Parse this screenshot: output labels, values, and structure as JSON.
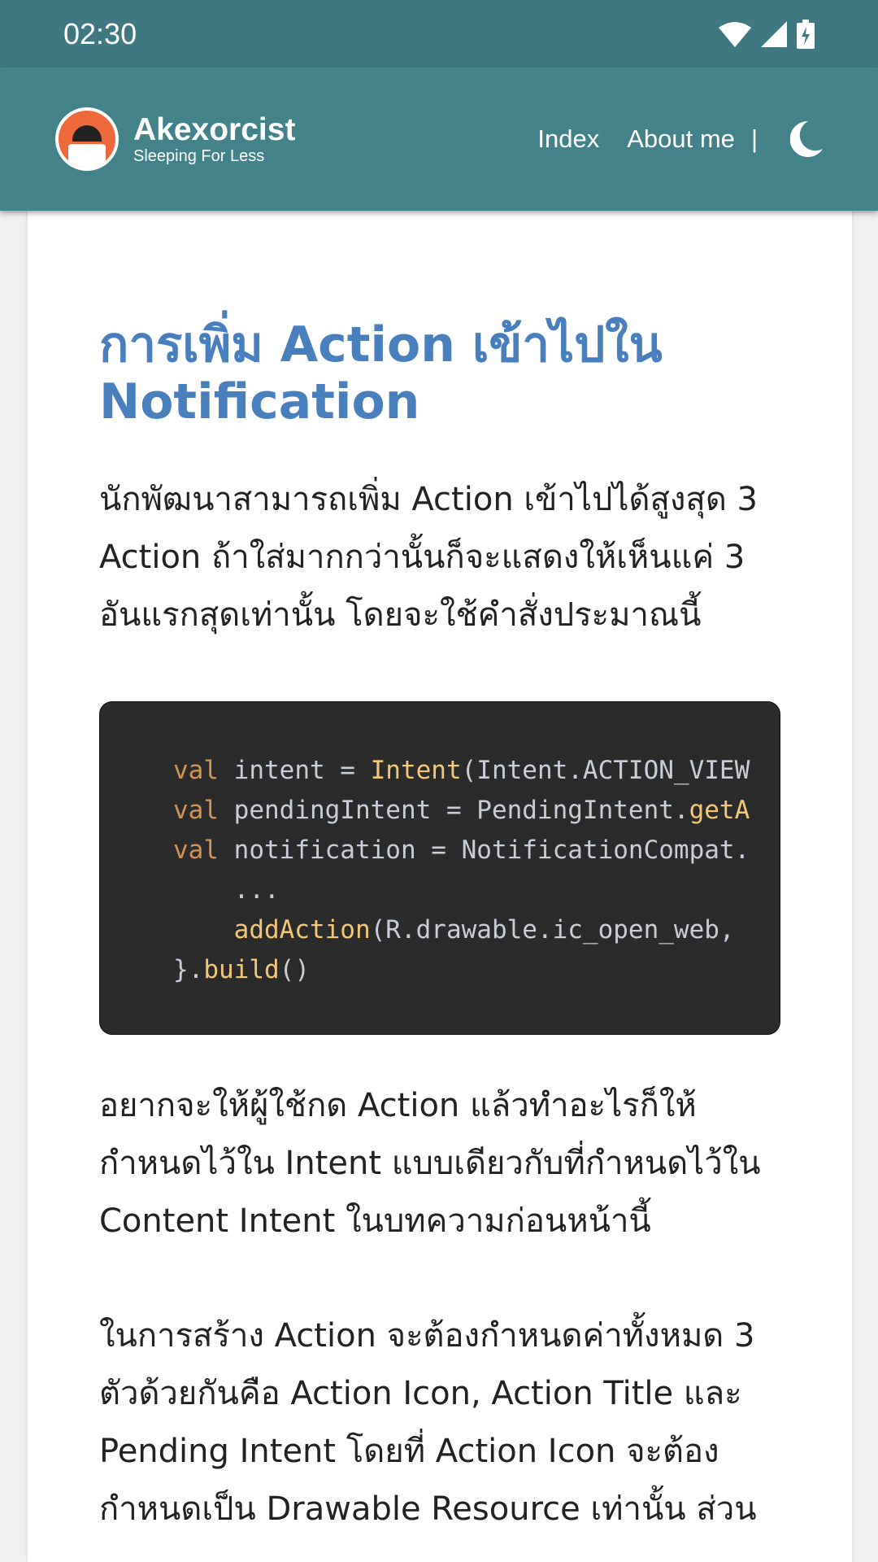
{
  "status": {
    "time": "02:30",
    "icons": [
      "wifi-icon",
      "signal-icon",
      "battery-charging-icon"
    ]
  },
  "header": {
    "site_name": "Akexorcist",
    "tagline": "Sleeping For Less",
    "nav": [
      "Index",
      "About me"
    ],
    "separator": "|",
    "theme_icon": "moon-icon"
  },
  "colors": {
    "status_bar": "#3f7880",
    "header": "#438289",
    "title": "#4a7fbe",
    "code_bg": "#2b2b2b"
  },
  "article": {
    "title": "การเพิ่ม Action เข้าไปใน Notification",
    "p1": "นักพัฒนาสามารถเพิ่ม Action เข้าไปได้สูงสุด 3 Action ถ้าใส่มากกว่านั้นก็จะแสดงให้เห็นแค่ 3 อันแรกสุดเท่านั้น โดยจะใช้คำสั่งประมาณนี้",
    "code": [
      [
        {
          "t": "val",
          "c": "kw"
        },
        {
          "t": " intent = "
        },
        {
          "t": "Intent",
          "c": "fn"
        },
        {
          "t": "(Intent.ACTION_VIEW"
        }
      ],
      [
        {
          "t": "val",
          "c": "kw"
        },
        {
          "t": " pendingIntent = PendingIntent."
        },
        {
          "t": "getA",
          "c": "fn"
        }
      ],
      [
        {
          "t": "val",
          "c": "kw"
        },
        {
          "t": " notification = NotificationCompat."
        }
      ],
      [
        {
          "t": "    ..."
        }
      ],
      [
        {
          "t": "    "
        },
        {
          "t": "addAction",
          "c": "fn"
        },
        {
          "t": "(R.drawable.ic_open_web,"
        }
      ],
      [
        {
          "t": "}."
        },
        {
          "t": "build",
          "c": "fn"
        },
        {
          "t": "()"
        }
      ]
    ],
    "p2": "อยากจะให้ผู้ใช้กด Action แล้วทำอะไรก็ให้กำหนดไว้ใน Intent แบบเดียวกับที่กำหนดไว้ใน Content Intent ในบทความก่อนหน้านี้",
    "p3": "ในการสร้าง Action จะต้องกำหนดค่าทั้งหมด 3 ตัวด้วยกันคือ Action Icon, Action Title และ Pending Intent โดยที่ Action Icon จะต้องกำหนดเป็น Drawable Resource เท่านั้น ส่วน"
  }
}
